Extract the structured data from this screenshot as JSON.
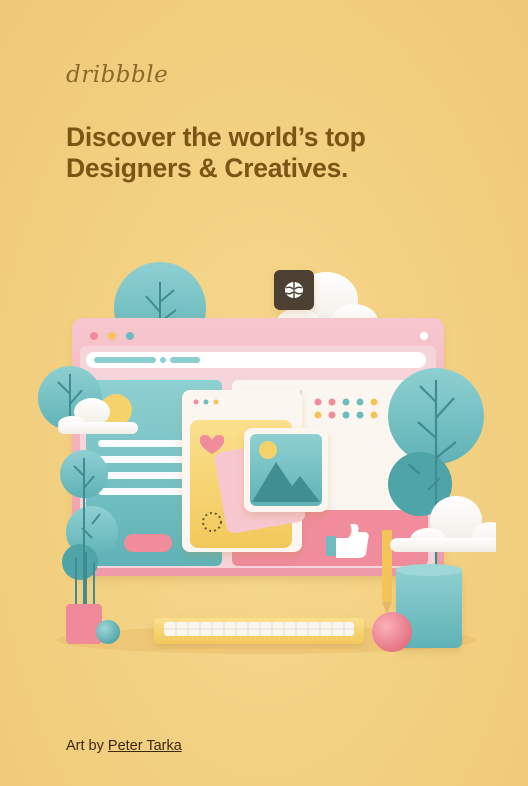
{
  "brand": {
    "logo_text": "dribbble"
  },
  "headline": {
    "line1": "Discover the world’s top",
    "line2": "Designers & Creatives."
  },
  "credit": {
    "prefix": "Art by",
    "artist": "Peter Tarka"
  },
  "colors": {
    "background": "#f2cf80",
    "headline": "#7a5514",
    "accent_teal": "#6fbcc0",
    "accent_pink": "#f08c9c"
  },
  "icons": {
    "brain_badge": "brain-icon",
    "thumbs_up": "thumbs-up-icon",
    "heart": "heart-icon",
    "image": "image-icon"
  }
}
